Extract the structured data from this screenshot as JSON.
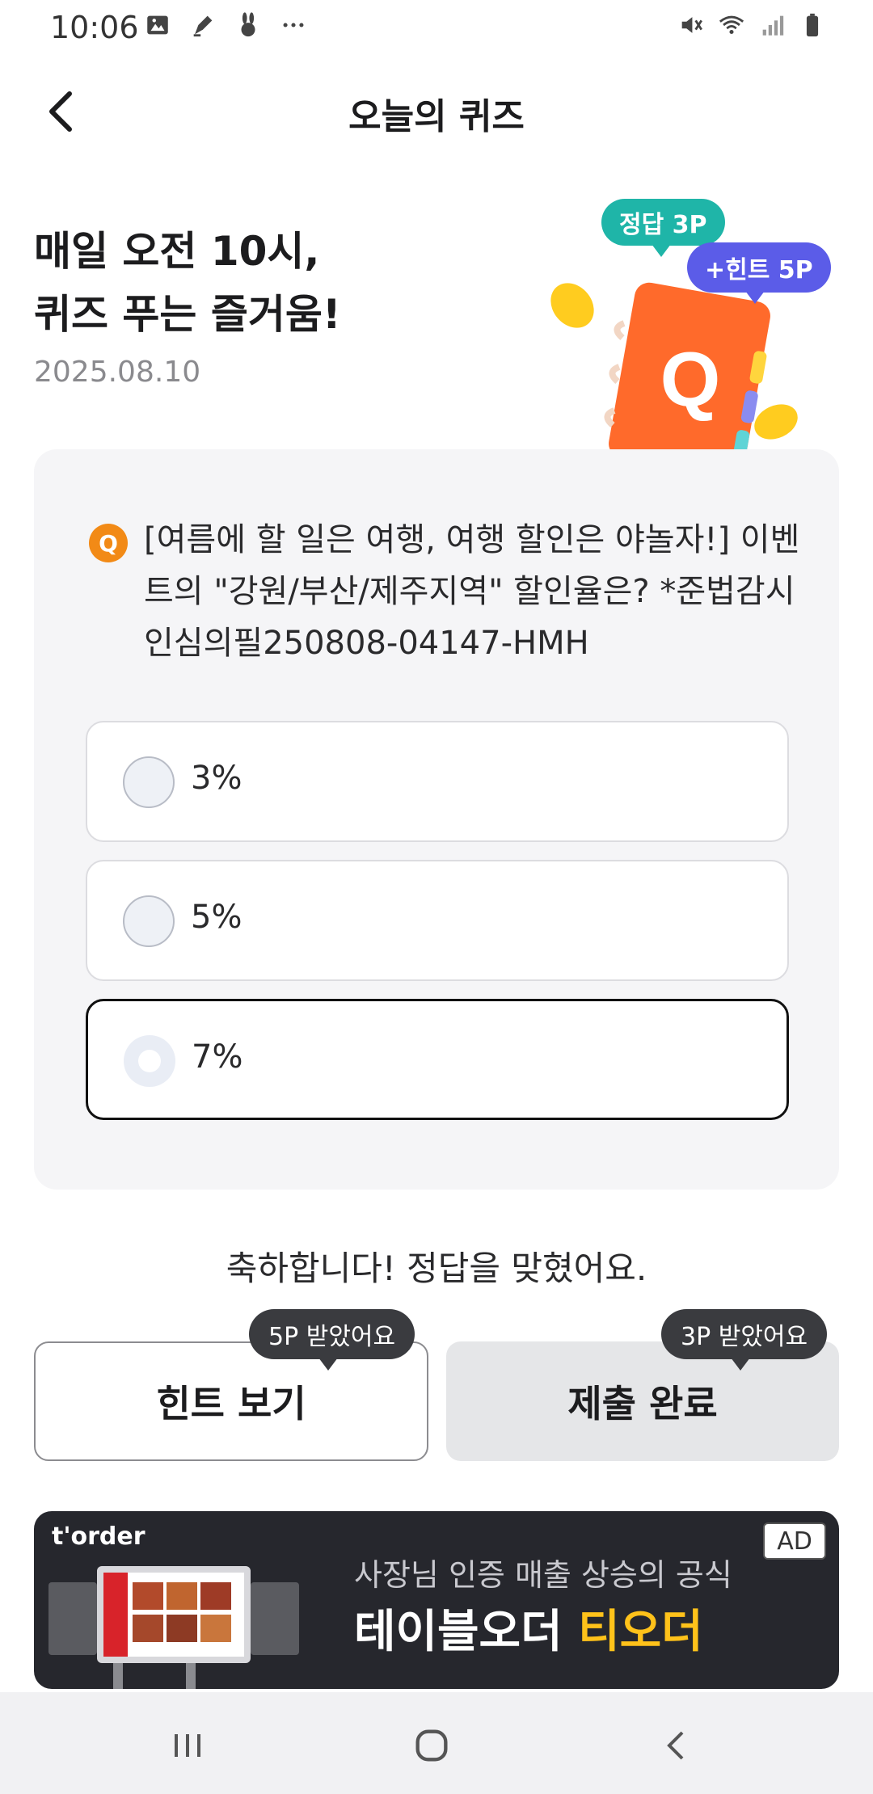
{
  "status": {
    "time": "10:06"
  },
  "header": {
    "title": "오늘의 퀴즈"
  },
  "hero": {
    "title": "매일 오전 10시,\n퀴즈 푸는 즐거움!",
    "date": "2025.08.10",
    "answer_bubble": "정답 3P",
    "hint_bubble": "+힌트 5P",
    "illustration_letter": "Q"
  },
  "quiz": {
    "badge": "Q",
    "question": "[여름에 할 일은 여행, 여행 할인은 야놀자!] 이벤트의 \"강원/부산/제주지역\" 할인율은? *준법감시인심의필250808-04147-HMH",
    "options": [
      {
        "label": "3%",
        "selected": false
      },
      {
        "label": "5%",
        "selected": false
      },
      {
        "label": "7%",
        "selected": true
      }
    ]
  },
  "result": {
    "message": "축하합니다! 정답을 맞혔어요."
  },
  "actions": {
    "hint_label": "힌트 보기",
    "hint_tip": "5P 받았어요",
    "submit_label": "제출 완료",
    "submit_tip": "3P 받았어요"
  },
  "ad": {
    "brand": "t'order",
    "badge": "AD",
    "subtitle": "사장님 인증 매출 상승의 공식",
    "title_main": "테이블오더 ",
    "title_accent": "티오더",
    "accent_color": "#ffc21a"
  },
  "colors": {
    "q_badge": "#f28a16",
    "answer_bubble": "#1fb5a8",
    "hint_bubble": "#5b5ce8",
    "tooltip": "#3a3b3f"
  }
}
